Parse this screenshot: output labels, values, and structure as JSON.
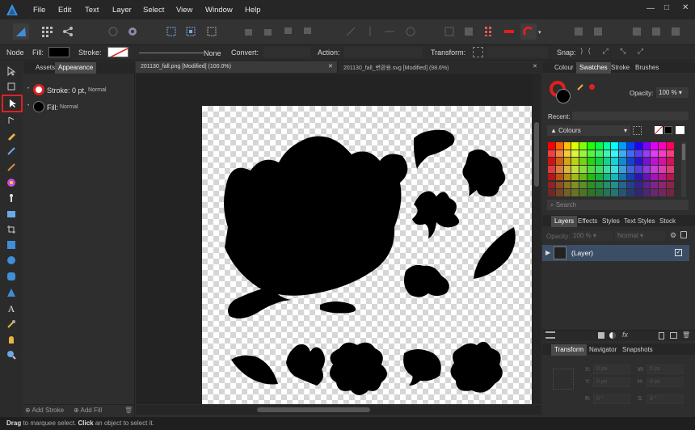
{
  "menu": [
    "File",
    "Edit",
    "Text",
    "Layer",
    "Select",
    "View",
    "Window",
    "Help"
  ],
  "window_controls": {
    "min": "—",
    "max": "□",
    "close": "✕"
  },
  "context": {
    "tool": "Node",
    "fill_label": "Fill:",
    "stroke_label": "Stroke:",
    "stroke_style": "None",
    "convert_label": "Convert:",
    "action_label": "Action:",
    "transform_label": "Transform:",
    "snap_label": "Snap:"
  },
  "left_panel": {
    "tabs": [
      "Assets",
      "Appearance"
    ],
    "stroke_row": "Stroke: 0 pt,",
    "stroke_mode": "Normal",
    "fill_row": "Fill:",
    "fill_mode": "Normal",
    "bottom_add_stroke": "Add Stroke",
    "bottom_add_fill": "Add Fill"
  },
  "docs": [
    {
      "title": "201130_fall.png [Modified] (100.0%)",
      "close": "✕"
    },
    {
      "title": "201130_fall_변환용.svg [Modified] (98.6%)",
      "close": "✕"
    }
  ],
  "swatches_panel": {
    "tabs": [
      "Colour",
      "Swatches",
      "Stroke",
      "Brushes"
    ],
    "opacity_label": "Opacity:",
    "opacity_value": "100 %",
    "recent_label": "Recent:",
    "palette": "Colours",
    "search_placeholder": "Search"
  },
  "layers_panel": {
    "tabs": [
      "Layers",
      "Effects",
      "Styles",
      "Text Styles",
      "Stock"
    ],
    "opacity_label": "Opacity:",
    "opacity_value": "100 %",
    "blend": "Normal",
    "layer_name": "(Layer)"
  },
  "transform_panel": {
    "tabs": [
      "Transform",
      "Navigator",
      "Snapshots"
    ],
    "fields": [
      {
        "label": "X:",
        "value": "0 px"
      },
      {
        "label": "Y:",
        "value": "0 px"
      },
      {
        "label": "W:",
        "value": "0 px"
      },
      {
        "label": "H:",
        "value": "0 px"
      },
      {
        "label": "R:",
        "value": "0 °"
      },
      {
        "label": "S:",
        "value": "0 °"
      }
    ]
  },
  "status": {
    "b1": "Drag",
    "t1": " to marquee select. ",
    "b2": "Click",
    "t2": " an object to select it."
  },
  "colors": {
    "accent": "#4a90d9",
    "highlight": "#e0201f",
    "active_layer": "#3c4e66"
  }
}
